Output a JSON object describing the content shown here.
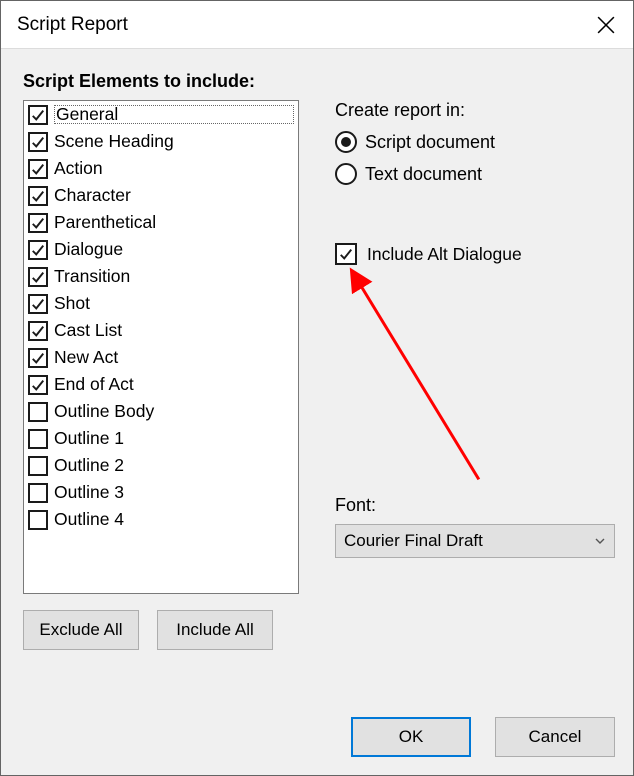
{
  "window": {
    "title": "Script Report"
  },
  "left": {
    "heading": "Script Elements to include:",
    "items": [
      {
        "label": "General",
        "checked": true,
        "focused": true
      },
      {
        "label": "Scene Heading",
        "checked": true
      },
      {
        "label": "Action",
        "checked": true
      },
      {
        "label": "Character",
        "checked": true
      },
      {
        "label": "Parenthetical",
        "checked": true
      },
      {
        "label": "Dialogue",
        "checked": true
      },
      {
        "label": "Transition",
        "checked": true
      },
      {
        "label": "Shot",
        "checked": true
      },
      {
        "label": "Cast List",
        "checked": true
      },
      {
        "label": "New Act",
        "checked": true
      },
      {
        "label": "End of Act",
        "checked": true
      },
      {
        "label": "Outline Body",
        "checked": false
      },
      {
        "label": "Outline 1",
        "checked": false
      },
      {
        "label": "Outline 2",
        "checked": false
      },
      {
        "label": "Outline 3",
        "checked": false
      },
      {
        "label": "Outline 4",
        "checked": false
      }
    ],
    "exclude_all_label": "Exclude All",
    "include_all_label": "Include All"
  },
  "right": {
    "create_in_label": "Create report in:",
    "radios": [
      {
        "label": "Script document",
        "selected": true
      },
      {
        "label": "Text document",
        "selected": false
      }
    ],
    "include_alt": {
      "label": "Include Alt Dialogue",
      "checked": true
    },
    "font_label": "Font:",
    "font_value": "Courier Final Draft"
  },
  "footer": {
    "ok_label": "OK",
    "cancel_label": "Cancel"
  },
  "annotation": {
    "color": "#ff0000"
  }
}
